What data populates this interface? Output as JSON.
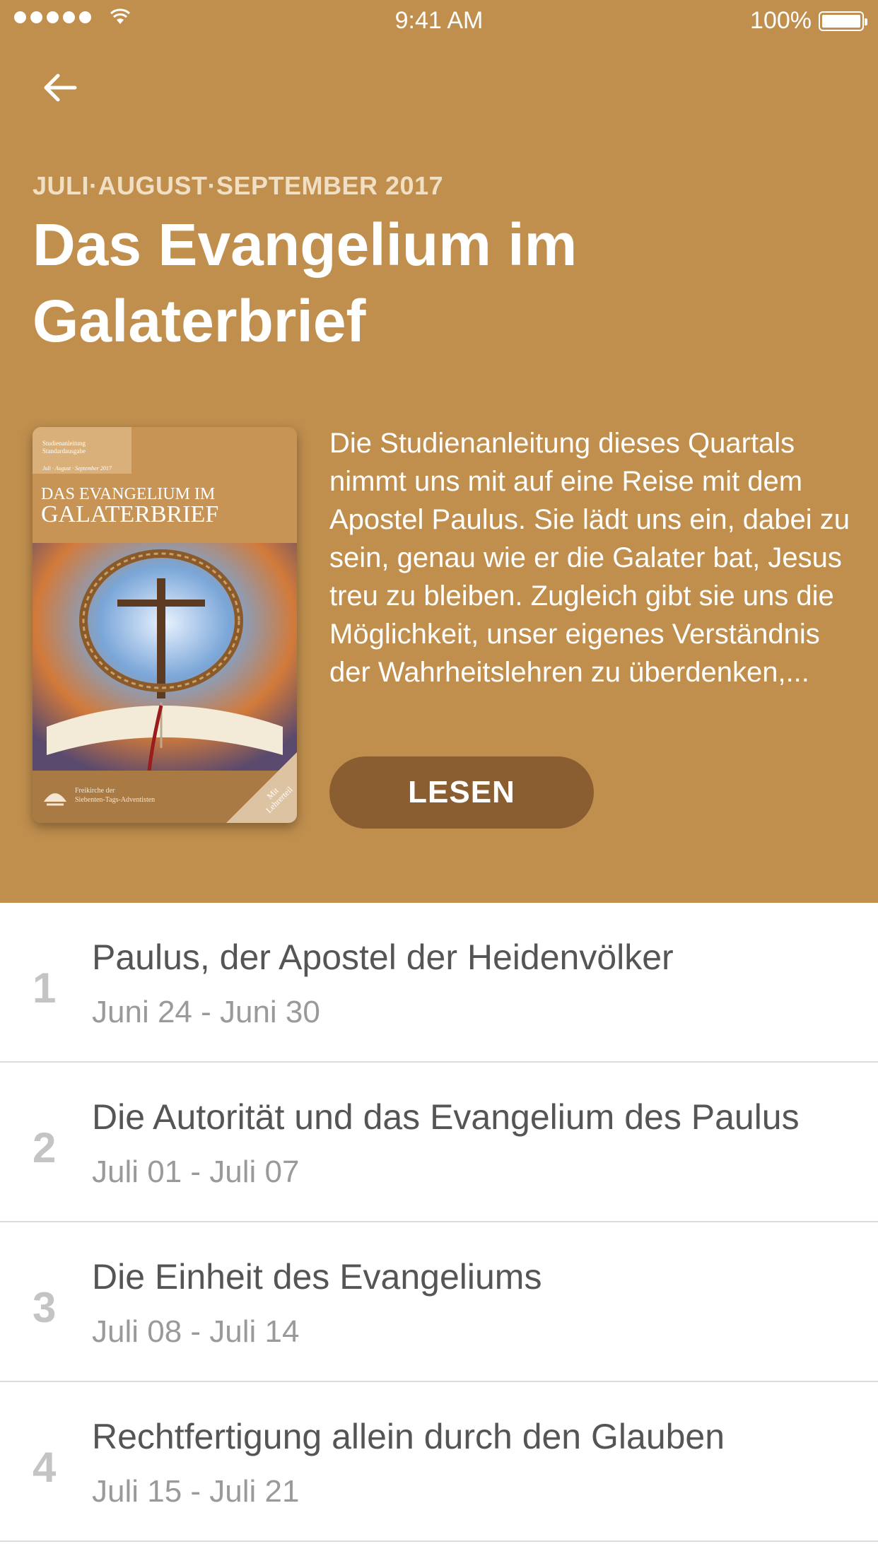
{
  "status_bar": {
    "time": "9:41 AM",
    "battery": "100%"
  },
  "header": {
    "quarter": "JULI·AUGUST·SEPTEMBER 2017",
    "title": "Das Evangelium im Galaterbrief",
    "description": "Die Studienanleitung dieses Quartals nimmt uns mit auf eine Reise mit dem Apostel Paulus. Sie lädt uns ein, dabei zu sein, genau wie er die Galater bat, Jesus treu zu bleiben. Zugleich gibt sie uns die Möglichkeit, unser eigenes Verständnis der Wahrheitslehren zu überdenken,...",
    "read_label": "LESEN",
    "accent_color": "#c08f4e",
    "button_color": "#8b5e32"
  },
  "cover": {
    "tag_line1": "Studienanleitung",
    "tag_line2": "Standardausgabe",
    "period": "Juli · August · September 2017",
    "title_line1": "DAS EVANGELIUM IM",
    "title_line2": "GALATERBRIEF",
    "org_line1": "Freikirche der",
    "org_line2": "Siebenten-Tags-Adventisten",
    "corner_line1": "Mit",
    "corner_line2": "Lehrerteil"
  },
  "lessons": [
    {
      "number": "1",
      "title": "Paulus, der Apostel der Heidenvölker",
      "dates": "Juni 24 - Juni 30"
    },
    {
      "number": "2",
      "title": "Die Autorität und das Evangelium des Paulus",
      "dates": "Juli 01 - Juli 07"
    },
    {
      "number": "3",
      "title": "Die Einheit des Evangeliums",
      "dates": "Juli 08 - Juli 14"
    },
    {
      "number": "4",
      "title": "Rechtfertigung allein durch den Glauben",
      "dates": "Juli 15 - Juli 21"
    }
  ]
}
